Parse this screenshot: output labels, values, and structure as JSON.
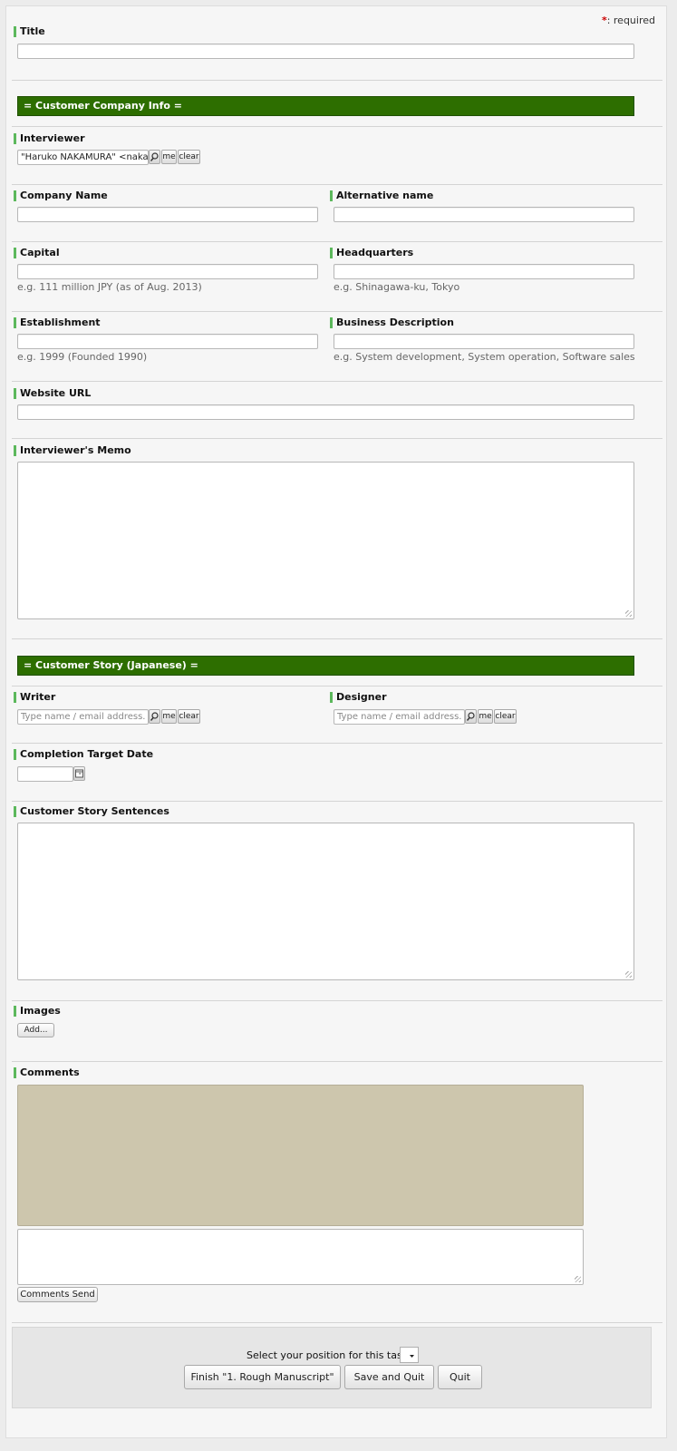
{
  "required_note": ": required",
  "title_label": "Title",
  "section_company": "= Customer Company Info =",
  "interviewer": {
    "label": "Interviewer",
    "value": "\"Haruko NAKAMURA\" <nakamur",
    "me": "me",
    "clear": "clear"
  },
  "company_name": {
    "label": "Company Name"
  },
  "alternative_name": {
    "label": "Alternative name"
  },
  "capital": {
    "label": "Capital",
    "hint": "e.g. 111 million JPY (as of Aug. 2013)"
  },
  "headquarters": {
    "label": "Headquarters",
    "hint": "e.g. Shinagawa-ku, Tokyo"
  },
  "establishment": {
    "label": "Establishment",
    "hint": "e.g. 1999 (Founded 1990)"
  },
  "business_description": {
    "label": "Business Description",
    "hint": "e.g. System development, System operation, Software sales"
  },
  "website_url": {
    "label": "Website URL"
  },
  "memo": {
    "label": "Interviewer's Memo"
  },
  "section_story": "= Customer Story (Japanese) =",
  "writer": {
    "label": "Writer",
    "placeholder": "Type name / email address.",
    "me": "me",
    "clear": "clear"
  },
  "designer": {
    "label": "Designer",
    "placeholder": "Type name / email address.",
    "me": "me",
    "clear": "clear"
  },
  "completion_date": {
    "label": "Completion Target Date"
  },
  "story_sentences": {
    "label": "Customer Story Sentences"
  },
  "images": {
    "label": "Images",
    "add": "Add..."
  },
  "comments": {
    "label": "Comments",
    "send": "Comments Send"
  },
  "footer": {
    "position_label": "Select your position for this task",
    "finish": "Finish \"1. Rough Manuscript\"",
    "save_quit": "Save and Quit",
    "quit": "Quit"
  },
  "colors": {
    "section_header": "#2d6e00",
    "label_marker": "#5cb85c",
    "comments_log": "#cdc6ad"
  }
}
